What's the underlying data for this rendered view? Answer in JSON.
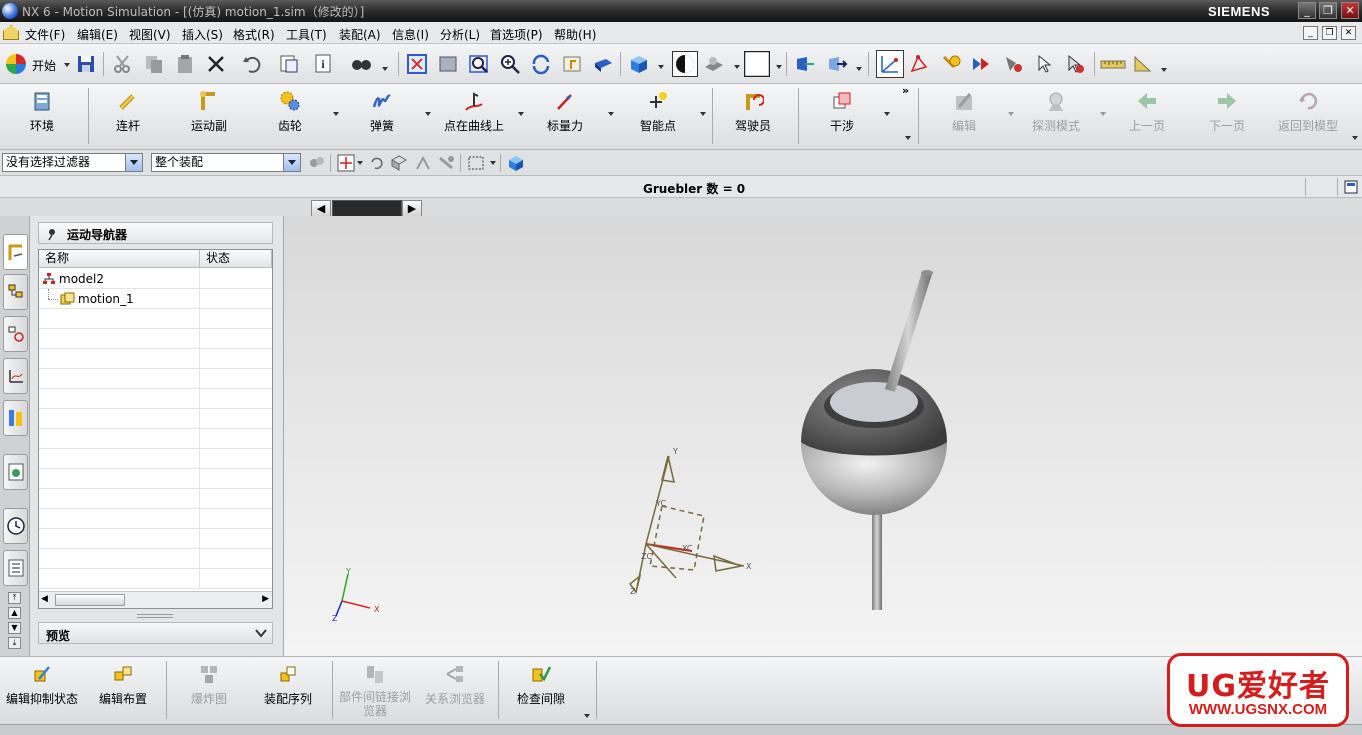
{
  "window": {
    "title": "NX 6 - Motion Simulation - [(仿真) motion_1.sim（修改的）]",
    "brand": "SIEMENS"
  },
  "menu": [
    "文件(F)",
    "编辑(E)",
    "视图(V)",
    "插入(S)",
    "格式(R)",
    "工具(T)",
    "装配(A)",
    "信息(I)",
    "分析(L)",
    "首选项(P)",
    "帮助(H)"
  ],
  "toolbar": {
    "start_label": "开始"
  },
  "ribbon": {
    "buttons": [
      {
        "label": "环境",
        "icon": "environment-icon",
        "enabled": true
      },
      {
        "label": "连杆",
        "icon": "link-icon",
        "enabled": true
      },
      {
        "label": "运动副",
        "icon": "joint-icon",
        "enabled": true
      },
      {
        "label": "齿轮",
        "icon": "gear-icon",
        "enabled": true
      },
      {
        "label": "弹簧",
        "icon": "spring-icon",
        "enabled": true
      },
      {
        "label": "点在曲线上",
        "icon": "point-on-curve-icon",
        "enabled": true
      },
      {
        "label": "标量力",
        "icon": "scalar-force-icon",
        "enabled": true
      },
      {
        "label": "智能点",
        "icon": "smart-point-icon",
        "enabled": true
      },
      {
        "label": "驾驶员",
        "icon": "driver-icon",
        "enabled": true
      },
      {
        "label": "干涉",
        "icon": "interference-icon",
        "enabled": true
      },
      {
        "label": "编辑",
        "icon": "edit-icon",
        "enabled": false
      },
      {
        "label": "探测模式",
        "icon": "probe-mode-icon",
        "enabled": false
      },
      {
        "label": "上一页",
        "icon": "prev-page-icon",
        "enabled": false
      },
      {
        "label": "下一页",
        "icon": "next-page-icon",
        "enabled": false
      },
      {
        "label": "返回到模型",
        "icon": "return-to-model-icon",
        "enabled": false
      }
    ]
  },
  "selection": {
    "filter": "没有选择过滤器",
    "scope": "整个装配"
  },
  "status": {
    "message": "Gruebler 数 = 0"
  },
  "navigator": {
    "title": "运动导航器",
    "columns": [
      "名称",
      "状态"
    ],
    "rows": [
      {
        "name": "model2",
        "status": "",
        "icon": "assembly-icon"
      },
      {
        "name": "motion_1",
        "status": "",
        "icon": "motion-icon"
      }
    ],
    "preview_label": "预览"
  },
  "viewport": {
    "axis_labels": {
      "x": "X",
      "y": "Y",
      "z": "Z",
      "xc": "XC",
      "yc": "YC",
      "zc": "ZC"
    }
  },
  "bottom_bar": {
    "buttons": [
      {
        "label": "编辑抑制状态",
        "enabled": true
      },
      {
        "label": "编辑布置",
        "enabled": true
      },
      {
        "label": "爆炸图",
        "enabled": false
      },
      {
        "label": "装配序列",
        "enabled": true
      },
      {
        "label": "部件间链接浏览器",
        "enabled": false
      },
      {
        "label": "关系浏览器",
        "enabled": false
      },
      {
        "label": "检查间隙",
        "enabled": true
      }
    ]
  },
  "watermark": {
    "line1": "UG爱好者",
    "line2": "WWW.UGSNX.COM"
  },
  "colors": {
    "brand_red": "#d41d1d",
    "title_bar": "#2b2b2b",
    "disabled_text": "#9c9ea0"
  }
}
